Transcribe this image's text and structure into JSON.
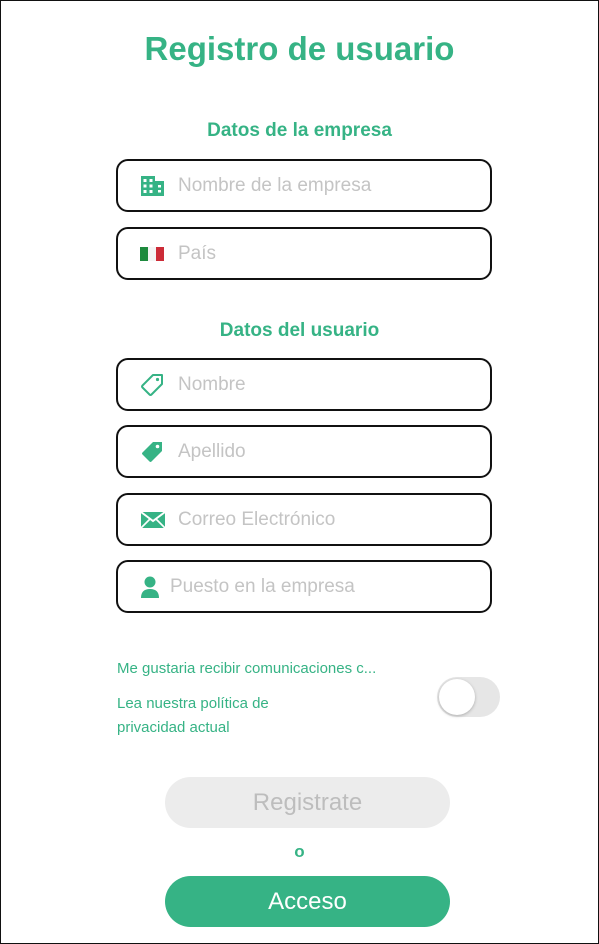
{
  "title": "Registro de usuario",
  "company_section": {
    "heading": "Datos de la empresa",
    "company_name_placeholder": "Nombre de la empresa",
    "country_placeholder": "País"
  },
  "user_section": {
    "heading": "Datos del usuario",
    "first_name_placeholder": "Nombre",
    "last_name_placeholder": "Apellido",
    "email_placeholder": "Correo Electrónico",
    "position_placeholder": "Puesto en la empresa"
  },
  "consent": {
    "communications_text": "Me gustaria recibir comunicaciones c...",
    "privacy_line1": "Lea nuestra política de",
    "privacy_line2": "privacidad actual",
    "toggle_on": false
  },
  "buttons": {
    "register_label": "Registrate",
    "or_label": "o",
    "login_label": "Acceso"
  },
  "icons": {
    "company": "building-icon",
    "country": "italy-flag-icon",
    "first_name": "tag-outline-icon",
    "last_name": "tag-filled-icon",
    "email": "envelope-icon",
    "position": "person-icon"
  },
  "colors": {
    "accent": "#36b385",
    "field_border": "#111111",
    "placeholder": "#c4c4c4",
    "disabled_button": "#ececec",
    "disabled_text": "#bdbdbd"
  }
}
